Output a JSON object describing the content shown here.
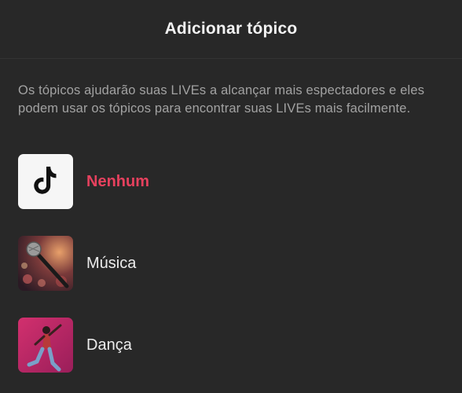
{
  "header": {
    "title": "Adicionar tópico"
  },
  "description": "Os tópicos ajudarão suas LIVEs a alcançar mais espectadores e eles podem usar os tópicos para encontrar suas LIVEs mais facilmente.",
  "topics": [
    {
      "label": "Nenhum",
      "icon": "tiktok-logo-icon",
      "selected": true
    },
    {
      "label": "Música",
      "icon": "microphone-image",
      "selected": false
    },
    {
      "label": "Dança",
      "icon": "dancer-image",
      "selected": false
    }
  ],
  "colors": {
    "accent": "#e6415e",
    "background": "#282828"
  }
}
